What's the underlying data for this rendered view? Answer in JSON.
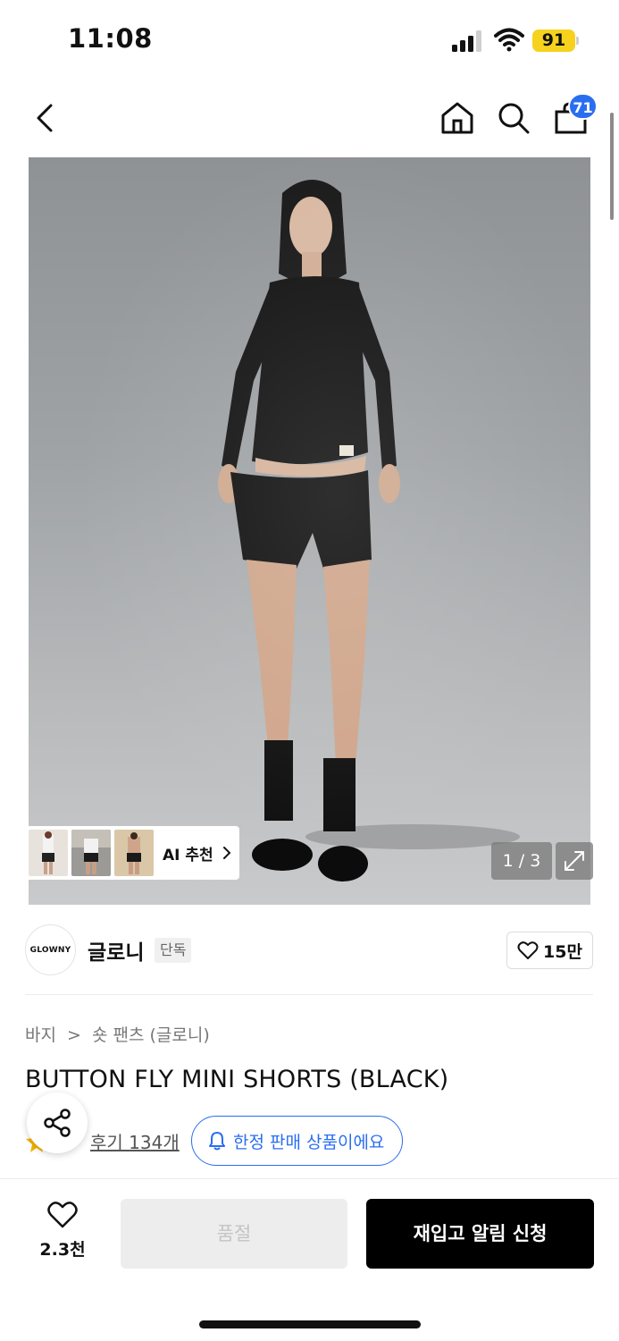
{
  "status_bar": {
    "time": "11:08",
    "battery_level": "91",
    "battery_color": "#f6d21f"
  },
  "nav": {
    "cart_count": "71",
    "badge_color": "#2a6ef0"
  },
  "gallery": {
    "ai_recommend_label": "AI 추천",
    "page_indicator": "1 / 3"
  },
  "brand": {
    "logo_text": "GLOWNY",
    "name": "글로니",
    "tag": "단독",
    "like_count": "15만"
  },
  "breadcrumb": {
    "items": [
      "바지",
      "숏 팬츠 (글로니)"
    ],
    "separator": ">"
  },
  "product": {
    "title": "BUTTON FLY MINI SHORTS (BLACK)",
    "review_link": "후기 134개",
    "limited_sale_text": "한정 판매 상품이에요"
  },
  "bottom_bar": {
    "wish_count": "2.3천",
    "sold_out_label": "품절",
    "restock_label": "재입고 알림 신청"
  }
}
